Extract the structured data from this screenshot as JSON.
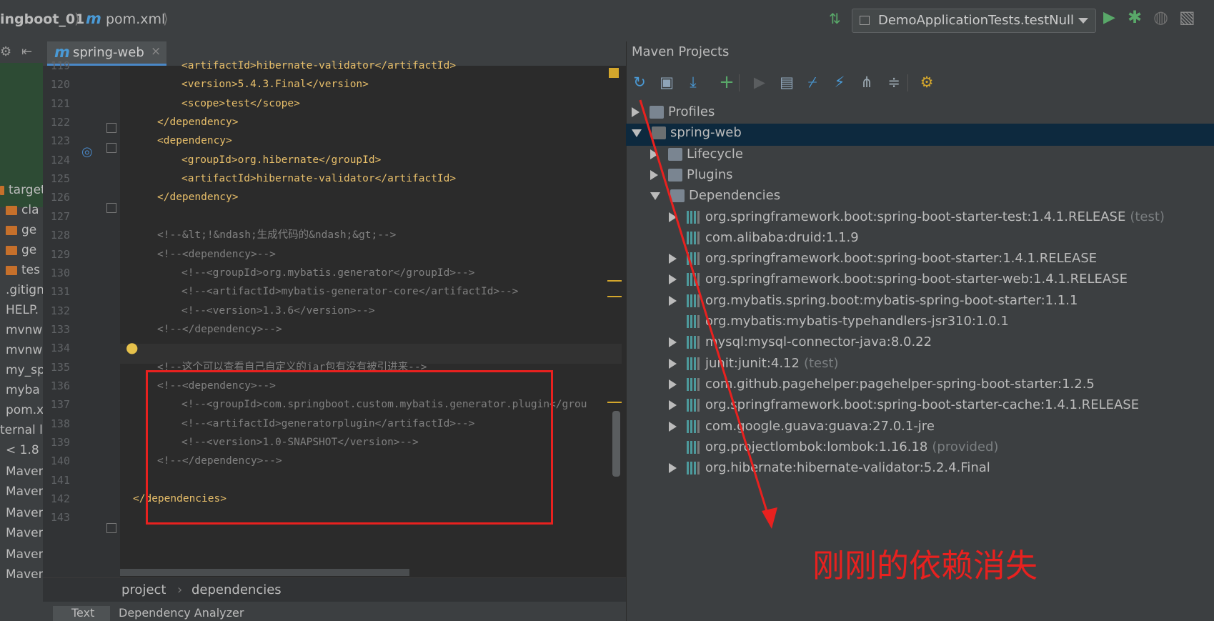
{
  "topbar": {
    "project_crumb": "ingboot_01",
    "file_crumb": "pom.xml",
    "run_config": "DemoApplicationTests.testNull",
    "icons": [
      "vcs-update-icon",
      "run-icon",
      "debug-icon",
      "coverage-icon",
      "profile-icon"
    ]
  },
  "editor": {
    "tab_label": "spring-web",
    "breadcrumb": [
      "project",
      "dependencies"
    ],
    "bottom_tabs": [
      "Text",
      "Dependency Analyzer"
    ],
    "lines": [
      {
        "n": "119",
        "text": "<artifactId>hibernate-validator</artifactId>",
        "kind": "tag",
        "indent": 3
      },
      {
        "n": "120",
        "text": "<version>5.4.3.Final</version>",
        "kind": "tag",
        "indent": 3
      },
      {
        "n": "121",
        "text": "<scope>test</scope>",
        "kind": "tag",
        "indent": 3
      },
      {
        "n": "122",
        "text": "</dependency>",
        "kind": "tag",
        "indent": 2
      },
      {
        "n": "123",
        "text": "<dependency>",
        "kind": "tag",
        "indent": 2
      },
      {
        "n": "124",
        "text": "<groupId>org.hibernate</groupId>",
        "kind": "tag",
        "indent": 3
      },
      {
        "n": "125",
        "text": "<artifactId>hibernate-validator</artifactId>",
        "kind": "tag",
        "indent": 3
      },
      {
        "n": "126",
        "text": "</dependency>",
        "kind": "tag",
        "indent": 2
      },
      {
        "n": "127",
        "text": "",
        "kind": "tag",
        "indent": 0
      },
      {
        "n": "128",
        "text": "<!--&lt;!&ndash;生成代码的&ndash;&gt;-->",
        "kind": "cmt",
        "indent": 2
      },
      {
        "n": "129",
        "text": "<!--<dependency>-->",
        "kind": "cmt",
        "indent": 2
      },
      {
        "n": "130",
        "text": "<!--<groupId>org.mybatis.generator</groupId>-->",
        "kind": "cmt",
        "indent": 3
      },
      {
        "n": "131",
        "text": "<!--<artifactId>mybatis-generator-core</artifactId>-->",
        "kind": "cmt",
        "indent": 3
      },
      {
        "n": "132",
        "text": "<!--<version>1.3.6</version>-->",
        "kind": "cmt",
        "indent": 3
      },
      {
        "n": "133",
        "text": "<!--</dependency>-->",
        "kind": "cmt",
        "indent": 2
      },
      {
        "n": "134",
        "text": "",
        "kind": "cmt",
        "indent": 0
      },
      {
        "n": "135",
        "text": "<!--这个可以查看自己自定义的jar包有没有被引进来-->",
        "kind": "cmt",
        "indent": 2
      },
      {
        "n": "136",
        "text": "<!--<dependency>-->",
        "kind": "cmt",
        "indent": 2
      },
      {
        "n": "137",
        "text": "<!--<groupId>com.springboot.custom.mybatis.generator.plugin</grou",
        "kind": "cmt",
        "indent": 3
      },
      {
        "n": "138",
        "text": "<!--<artifactId>generatorplugin</artifactId>-->",
        "kind": "cmt",
        "indent": 3
      },
      {
        "n": "139",
        "text": "<!--<version>1.0-SNAPSHOT</version>-->",
        "kind": "cmt",
        "indent": 3
      },
      {
        "n": "140",
        "text": "<!--</dependency>-->",
        "kind": "cmt",
        "indent": 2
      },
      {
        "n": "141",
        "text": "",
        "kind": "cmt",
        "indent": 0
      },
      {
        "n": "142",
        "text": "</dependencies>",
        "kind": "tag",
        "indent": 1
      },
      {
        "n": "143",
        "text": "",
        "kind": "tag",
        "indent": 0
      }
    ]
  },
  "project_panel": {
    "items": [
      "target",
      "cla",
      "ge",
      "ge",
      "tes",
      ".gitign",
      "HELP.",
      "mvnw",
      "mvnw",
      "my_sp",
      "myba",
      "pom.x",
      "ternal l",
      "< 1.8",
      "Maven",
      "Maven",
      "Maven",
      "Maven",
      "Maven",
      "Maven"
    ]
  },
  "maven": {
    "title": "Maven Projects",
    "tree": [
      {
        "label": "Profiles",
        "level": 0,
        "arrow": "right",
        "icon": "folder",
        "scope": ""
      },
      {
        "label": "spring-web",
        "level": 0,
        "arrow": "down",
        "icon": "module",
        "scope": "",
        "selected": true
      },
      {
        "label": "Lifecycle",
        "level": 1,
        "arrow": "right",
        "icon": "folder",
        "scope": ""
      },
      {
        "label": "Plugins",
        "level": 1,
        "arrow": "right",
        "icon": "folder",
        "scope": ""
      },
      {
        "label": "Dependencies",
        "level": 1,
        "arrow": "down",
        "icon": "folder",
        "scope": ""
      },
      {
        "label": "org.springframework.boot:spring-boot-starter-test:1.4.1.RELEASE",
        "level": 2,
        "arrow": "right",
        "icon": "dep",
        "scope": "(test)"
      },
      {
        "label": "com.alibaba:druid:1.1.9",
        "level": 2,
        "arrow": "none",
        "icon": "dep",
        "scope": ""
      },
      {
        "label": "org.springframework.boot:spring-boot-starter:1.4.1.RELEASE",
        "level": 2,
        "arrow": "right",
        "icon": "dep",
        "scope": ""
      },
      {
        "label": "org.springframework.boot:spring-boot-starter-web:1.4.1.RELEASE",
        "level": 2,
        "arrow": "right",
        "icon": "dep",
        "scope": ""
      },
      {
        "label": "org.mybatis.spring.boot:mybatis-spring-boot-starter:1.1.1",
        "level": 2,
        "arrow": "right",
        "icon": "dep",
        "scope": ""
      },
      {
        "label": "org.mybatis:mybatis-typehandlers-jsr310:1.0.1",
        "level": 2,
        "arrow": "none",
        "icon": "dep",
        "scope": ""
      },
      {
        "label": "mysql:mysql-connector-java:8.0.22",
        "level": 2,
        "arrow": "right",
        "icon": "dep",
        "scope": ""
      },
      {
        "label": "junit:junit:4.12",
        "level": 2,
        "arrow": "right",
        "icon": "dep",
        "scope": "(test)"
      },
      {
        "label": "com.github.pagehelper:pagehelper-spring-boot-starter:1.2.5",
        "level": 2,
        "arrow": "right",
        "icon": "dep",
        "scope": ""
      },
      {
        "label": "org.springframework.boot:spring-boot-starter-cache:1.4.1.RELEASE",
        "level": 2,
        "arrow": "right",
        "icon": "dep",
        "scope": ""
      },
      {
        "label": "com.google.guava:guava:27.0.1-jre",
        "level": 2,
        "arrow": "right",
        "icon": "dep",
        "scope": ""
      },
      {
        "label": "org.projectlombok:lombok:1.16.18",
        "level": 2,
        "arrow": "none",
        "icon": "dep",
        "scope": "(provided)"
      },
      {
        "label": "org.hibernate:hibernate-validator:5.2.4.Final",
        "level": 2,
        "arrow": "right",
        "icon": "dep",
        "scope": ""
      }
    ]
  },
  "annotation": {
    "text": "刚刚的依赖消失",
    "color": "#e8211f"
  },
  "colors": {
    "tag": "#e8bf6a",
    "comment": "#808080",
    "selection": "#0d293e",
    "accent": "#4a9ad6"
  }
}
